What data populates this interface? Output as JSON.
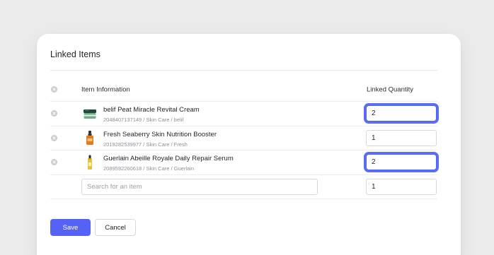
{
  "dialog": {
    "title": "Linked Items"
  },
  "table": {
    "col_info": "Item Information",
    "col_qty": "Linked Quantity",
    "rows": [
      {
        "name": "belif Peat Miracle Revital Cream",
        "meta": "2048407137149 / Skin Care / belif",
        "quantity": "2",
        "focused": true,
        "icon": "jar-icon"
      },
      {
        "name": "Fresh Seaberry Skin Nutrition Booster",
        "meta": "2019282539977 / Skin Care / Fresh",
        "quantity": "1",
        "focused": false,
        "icon": "dropper-bottle-icon"
      },
      {
        "name": "Guerlain Abeille Royale Daily Repair Serum",
        "meta": "2089592260618 / Skin Care / Guerlain",
        "quantity": "2",
        "focused": true,
        "icon": "serum-bottle-icon"
      }
    ],
    "new_row": {
      "search_placeholder": "Search for an item",
      "quantity": "1"
    }
  },
  "actions": {
    "save_label": "Save",
    "cancel_label": "Cancel"
  },
  "colors": {
    "accent": "#5562f6",
    "focus_ring": "#5a6cf8",
    "background": "#ebebeb"
  }
}
